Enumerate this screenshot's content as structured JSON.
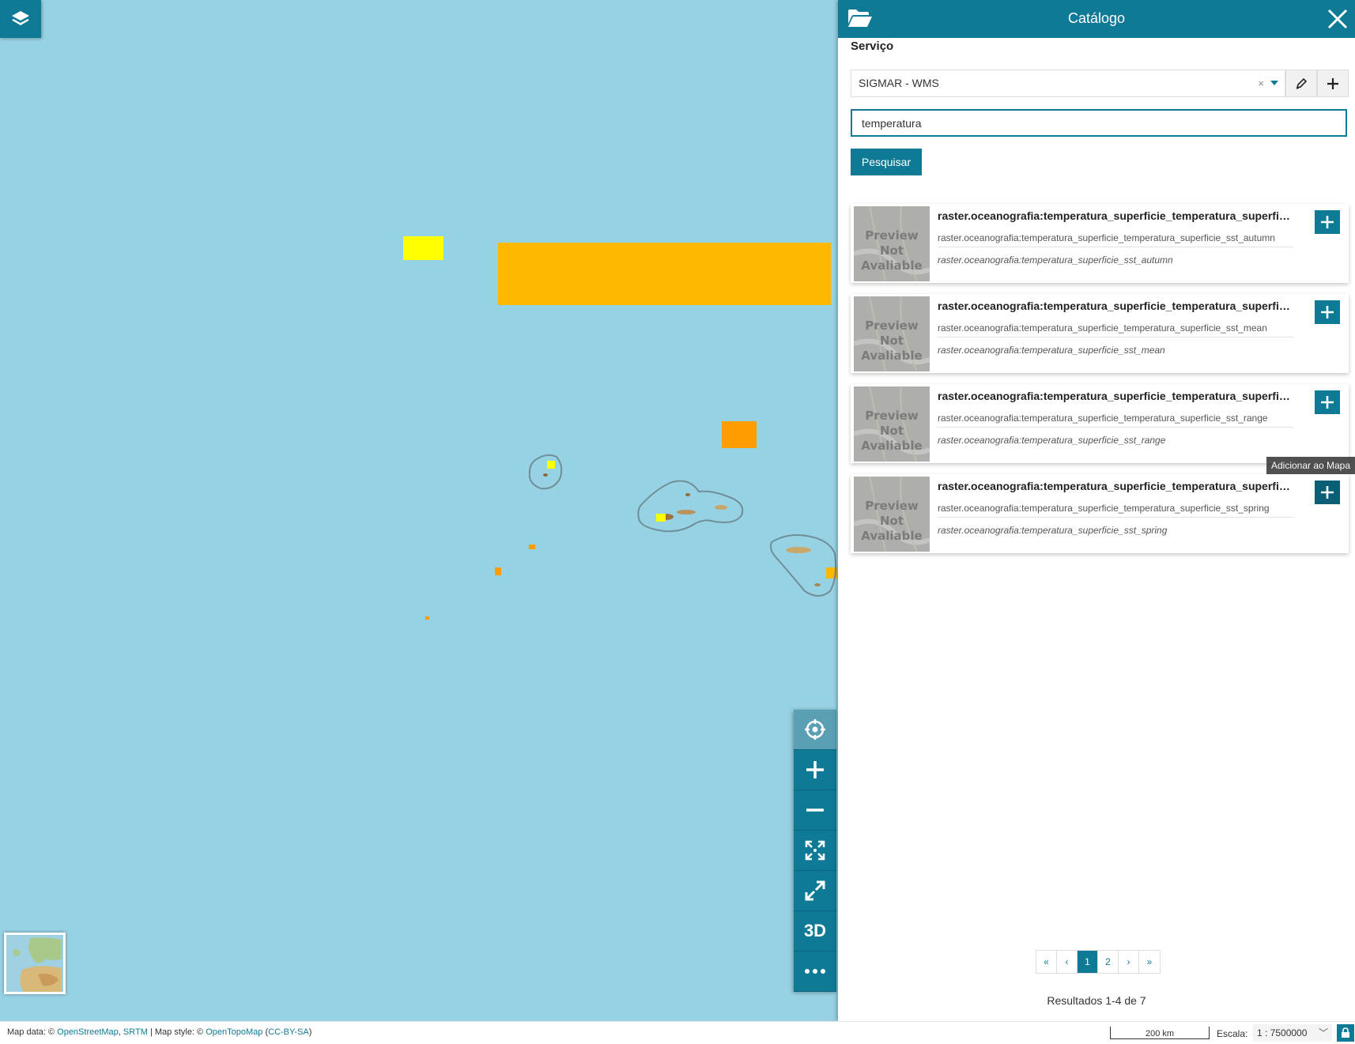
{
  "panel": {
    "title": "Catálogo",
    "service_label": "Serviço",
    "service_value": "SIGMAR - WMS",
    "service_clear": "×",
    "search_value": "temperatura",
    "search_button": "Pesquisar",
    "tooltip": "Adicionar ao Mapa",
    "results_count": "Resultados 1-4 de 7",
    "preview_text_1": "Preview Not",
    "preview_text_2": "Avaliable",
    "records": [
      {
        "title": "raster.oceanografia:temperatura_superficie_temperatura_superficie_sst_autumn",
        "subtitle": "raster.oceanografia:temperatura_superficie_temperatura_superficie_sst_autumn",
        "description": "raster.oceanografia:temperatura_superficie_sst_autumn"
      },
      {
        "title": "raster.oceanografia:temperatura_superficie_temperatura_superficie_sst_mean",
        "subtitle": "raster.oceanografia:temperatura_superficie_temperatura_superficie_sst_mean",
        "description": "raster.oceanografia:temperatura_superficie_sst_mean"
      },
      {
        "title": "raster.oceanografia:temperatura_superficie_temperatura_superficie_sst_range",
        "subtitle": "raster.oceanografia:temperatura_superficie_temperatura_superficie_sst_range",
        "description": "raster.oceanografia:temperatura_superficie_sst_range"
      },
      {
        "title": "raster.oceanografia:temperatura_superficie_temperatura_superficie_sst_spring",
        "subtitle": "raster.oceanografia:temperatura_superficie_temperatura_superficie_sst_spring",
        "description": "raster.oceanografia:temperatura_superficie_sst_spring"
      }
    ],
    "pagination": {
      "first": "«",
      "prev": "‹",
      "pages": [
        "1",
        "2"
      ],
      "current_page": "1",
      "next": "›",
      "last": "»"
    }
  },
  "map": {
    "tools": [
      "locate-icon",
      "zoom-in-icon",
      "zoom-out-icon",
      "zoom-extent-icon",
      "fullscreen-icon",
      "3d-toggle",
      "more-icon"
    ],
    "tool_3d_label": "3D"
  },
  "footer": {
    "attribution_prefix": "Map data: © ",
    "attribution_link1": "OpenStreetMap",
    "attribution_sep1": ", ",
    "attribution_link2": "SRTM",
    "attribution_mid": " | Map style: © ",
    "attribution_link3": "OpenTopoMap",
    "attribution_paren_open": " (",
    "attribution_link4": "CC-BY-SA",
    "attribution_paren_close": ")",
    "scale_bar": "200 km",
    "scale_label": "Escala:",
    "scale_value": "1 : 7500000"
  },
  "colors": {
    "accent": "#0f7a96",
    "sea": "#97d2e4",
    "layer_orange": "#ffb800",
    "layer_yellow": "#ffff00"
  }
}
